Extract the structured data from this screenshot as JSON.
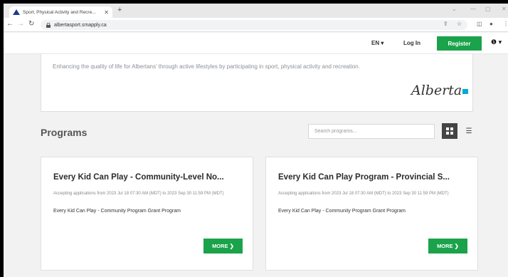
{
  "browser": {
    "tab_title": "Sport, Physical Activity and Recre...",
    "url": "albertasport.smapply.ca"
  },
  "header": {
    "language": "EN ▾",
    "login": "Log In",
    "register": "Register"
  },
  "hero": {
    "tagline": "Enhancing the quality of life for Albertans' through active lifestyles by participating in sport, physical activity and recreation.",
    "logo_text": "Alberta"
  },
  "programs": {
    "heading": "Programs",
    "search_placeholder": "Search programs...",
    "cards": [
      {
        "title": "Every Kid Can Play - Community-Level No...",
        "dates": "Accepting applications from 2023 Jul 18 07:30 AM (MDT) to 2023 Sep 30 11:59 PM (MDT)",
        "program": "Every Kid Can Play - Community Program Grant Program",
        "more": "MORE ❯"
      },
      {
        "title": "Every Kid Can Play Program - Provincial S...",
        "dates": "Accepting applications from 2023 Jul 18 07:30 AM (MDT) to 2023 Sep 30 11:59 PM (MDT)",
        "program": "Every Kid Can Play - Community Program Grant Program",
        "more": "MORE ❯"
      }
    ]
  },
  "colors": {
    "accent_green": "#1aa34a",
    "alberta_blue": "#00aad2"
  }
}
